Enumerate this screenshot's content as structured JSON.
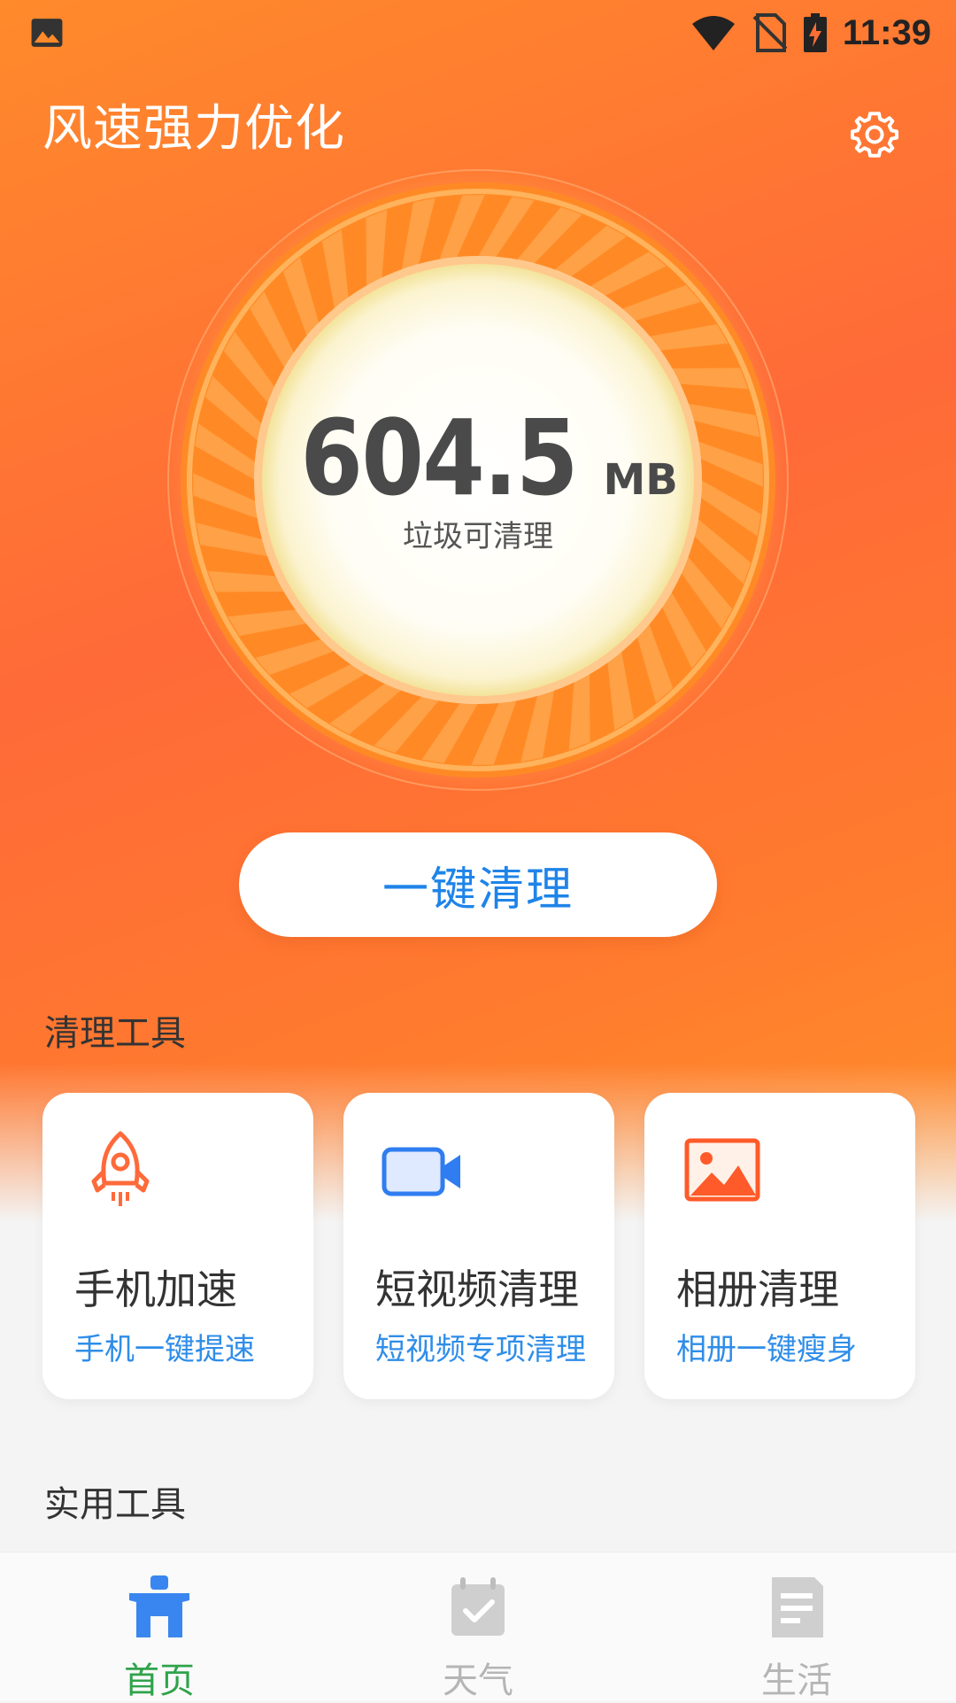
{
  "status_bar": {
    "time": "11:39"
  },
  "header": {
    "title": "风速强力优化"
  },
  "dial": {
    "value": "604.5",
    "unit": "MB",
    "caption": "垃圾可清理"
  },
  "actions": {
    "clean_label": "一键清理"
  },
  "clean_tools": {
    "title": "清理工具",
    "items": [
      {
        "name": "手机加速",
        "desc": "手机一键提速",
        "icon": "rocket-icon"
      },
      {
        "name": "短视频清理",
        "desc": "短视频专项清理",
        "icon": "video-camera-icon"
      },
      {
        "name": "相册清理",
        "desc": "相册一键瘦身",
        "icon": "photo-album-icon"
      }
    ]
  },
  "utility_tools": {
    "title": "实用工具"
  },
  "bottom_nav": {
    "items": [
      {
        "label": "首页",
        "icon": "home-icon",
        "active": true
      },
      {
        "label": "天气",
        "icon": "calendar-check-icon",
        "active": false
      },
      {
        "label": "生活",
        "icon": "document-icon",
        "active": false
      }
    ]
  },
  "colors": {
    "accent": "#ff6a38",
    "link": "#2f8de8",
    "nav_active": "#2fa34a",
    "nav_inactive": "#b5b5b5"
  }
}
